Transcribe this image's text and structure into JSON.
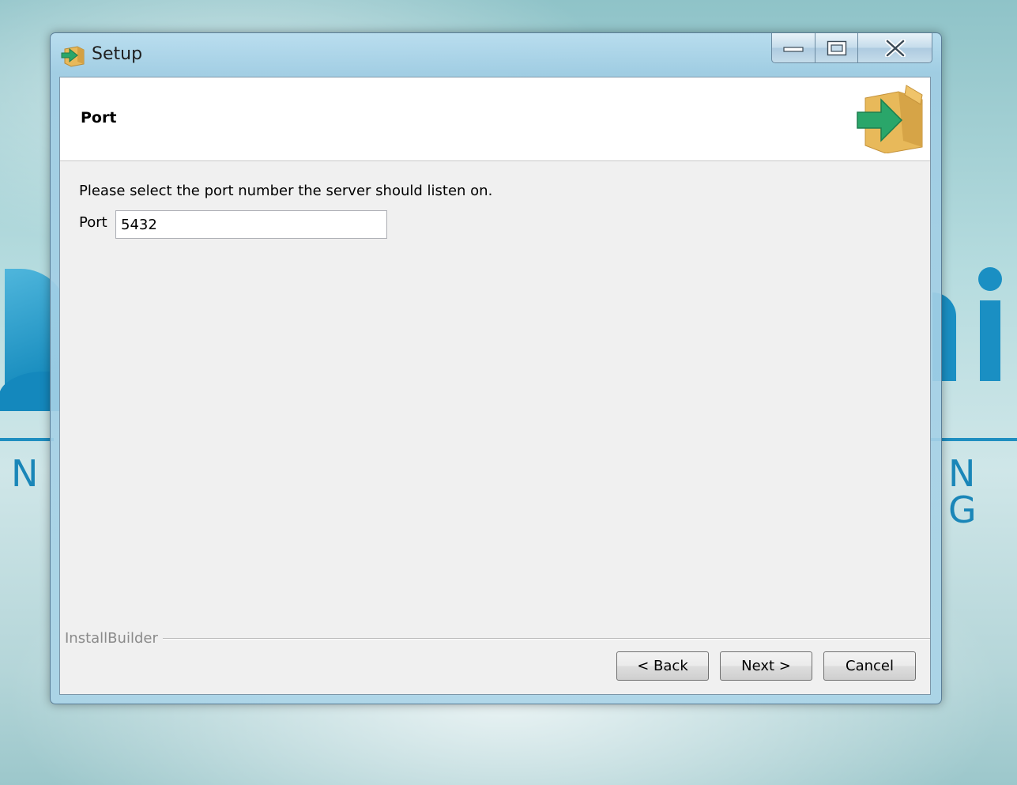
{
  "window": {
    "title": "Setup",
    "icon": "installer-box-arrow-icon"
  },
  "header": {
    "title": "Port",
    "icon": "installer-box-arrow-icon"
  },
  "content": {
    "instruction": "Please select the port number the server should listen on.",
    "port_label": "Port",
    "port_value": "5432"
  },
  "footer": {
    "brand": "InstallBuilder",
    "back_label": "< Back",
    "next_label": "Next >",
    "cancel_label": "Cancel"
  },
  "desktop": {
    "letters_left": "N",
    "letters_right": "N G"
  },
  "colors": {
    "accent_green": "#2aa66a",
    "box_tan": "#e8b95a",
    "brand_blue": "#1a8fc3"
  }
}
